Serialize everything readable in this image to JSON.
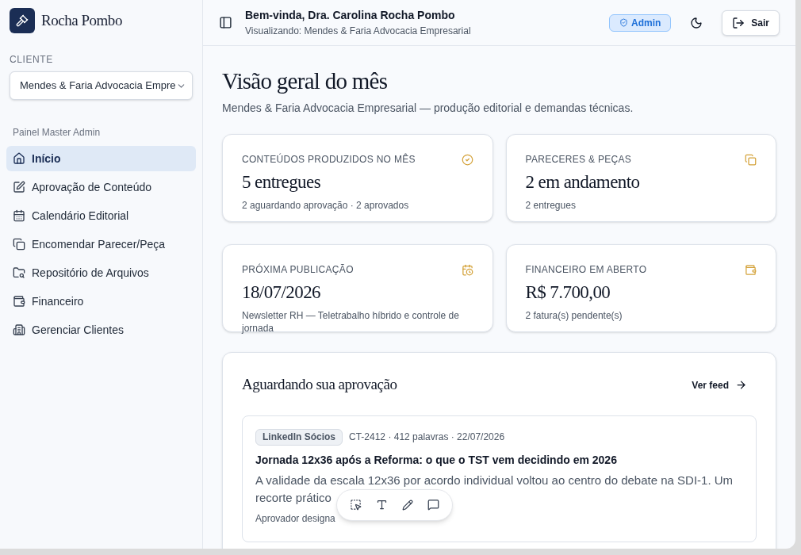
{
  "brand": {
    "name": "Rocha Pombo"
  },
  "client_picker": {
    "label": "CLIENTE",
    "value": "Mendes & Faria Advocacia Empre"
  },
  "nav": {
    "section": "Painel Master Admin",
    "items": [
      {
        "label": "Início",
        "selected": true
      },
      {
        "label": "Aprovação de Conteúdo",
        "selected": false
      },
      {
        "label": "Calendário Editorial",
        "selected": false
      },
      {
        "label": "Encomendar Parecer/Peça",
        "selected": false
      },
      {
        "label": "Repositório de Arquivos",
        "selected": false
      },
      {
        "label": "Financeiro",
        "selected": false
      },
      {
        "label": "Gerenciar Clientes",
        "selected": false
      }
    ]
  },
  "header": {
    "greeting": "Bem-vinda, Dra. Carolina Rocha Pombo",
    "viewing": "Visualizando: Mendes & Faria Advocacia Empresarial",
    "role_badge": "Admin",
    "logout": "Sair"
  },
  "page": {
    "title": "Visão geral do mês",
    "subtitle": "Mendes & Faria Advocacia Empresarial — produção editorial e demandas técnicas."
  },
  "stats": [
    {
      "label": "CONTEÚDOS PRODUZIDOS NO MÊS",
      "value": "5 entregues",
      "detail": "2 aguardando aprovação · 2 aprovados"
    },
    {
      "label": "PARECERES & PEÇAS",
      "value": "2 em andamento",
      "detail": "2 entregues"
    },
    {
      "label": "PRÓXIMA PUBLICAÇÃO",
      "value": "18/07/2026",
      "detail": "Newsletter RH — Teletrabalho híbrido e controle de jornada"
    },
    {
      "label": "FINANCEIRO EM ABERTO",
      "value": "R$ 7.700,00",
      "detail": "2 fatura(s) pendente(s)"
    }
  ],
  "approvals": {
    "title": "Aguardando sua aprovação",
    "link": "Ver feed",
    "items": [
      {
        "tag": "LinkedIn Sócios",
        "meta": "CT-2412 · 412 palavras · 22/07/2026",
        "title": "Jornada 12x36 após a Reforma: o que o TST vem decidindo em 2026",
        "excerpt_line": "A validade da escala 12x36 por acordo individual voltou ao centro do debate na SDI-1. Um",
        "excerpt_cut": "recorte prático",
        "approver": "Aprovador designa"
      }
    ]
  }
}
